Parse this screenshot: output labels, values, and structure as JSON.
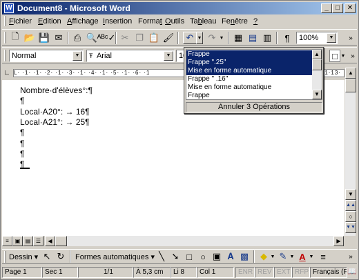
{
  "window": {
    "title": "Document8 - Microsoft Word"
  },
  "menu": [
    {
      "label": "Fichier",
      "key": "F"
    },
    {
      "label": "Edition",
      "key": "E"
    },
    {
      "label": "Affichage",
      "key": "A"
    },
    {
      "label": "Insertion",
      "key": "I"
    },
    {
      "label": "Format",
      "key": "t"
    },
    {
      "label": "Outils",
      "key": "O"
    },
    {
      "label": "Tableau",
      "key": "b"
    },
    {
      "label": "Fenêtre",
      "key": "n"
    },
    {
      "label": "?",
      "key": "?"
    }
  ],
  "standard_toolbar": {
    "zoom": "100%"
  },
  "format_toolbar": {
    "style": "Normal",
    "font": "Arial",
    "size": "10"
  },
  "ruler": {
    "text": "L·  ·1·  ·1·  ·2·  ·1·  ·3·  ·1·  ·4·  ·1·  ·5·  ·1·  ·6·  ·1",
    "right_text": "·1·13·"
  },
  "document": {
    "lines": [
      "Nombre·d'élèves°:¶",
      "¶",
      "Local·A20°:  →  16¶",
      "Local·A21°:  →  25¶",
      "¶",
      "¶",
      "¶",
      "¶"
    ]
  },
  "undo_dropdown": {
    "items": [
      {
        "label": "Frappe",
        "selected": true
      },
      {
        "label": "Frappe \".25\"",
        "selected": true
      },
      {
        "label": "Mise en forme automatique",
        "selected": true
      },
      {
        "label": "Frappe \" .16\"",
        "selected": false
      },
      {
        "label": "Mise en forme automatique",
        "selected": false
      },
      {
        "label": "Frappe",
        "selected": false
      }
    ],
    "footer": "Annuler 3 Opérations"
  },
  "drawing_toolbar": {
    "draw": "Dessin",
    "shapes": "Formes automatiques"
  },
  "status": {
    "page": "Page 1",
    "section": "Sec 1",
    "pages": "1/1",
    "at": "À 5,3 cm",
    "line": "Li 8",
    "col": "Col 1",
    "enr": "ENR",
    "rev": "REV",
    "ext": "EXT",
    "rfp": "RFP",
    "lang": "Français (F"
  },
  "colors": {
    "title_start": "#0a246a",
    "title_end": "#a6caf0",
    "selection": "#0a246a",
    "chrome": "#d4d0c8"
  }
}
